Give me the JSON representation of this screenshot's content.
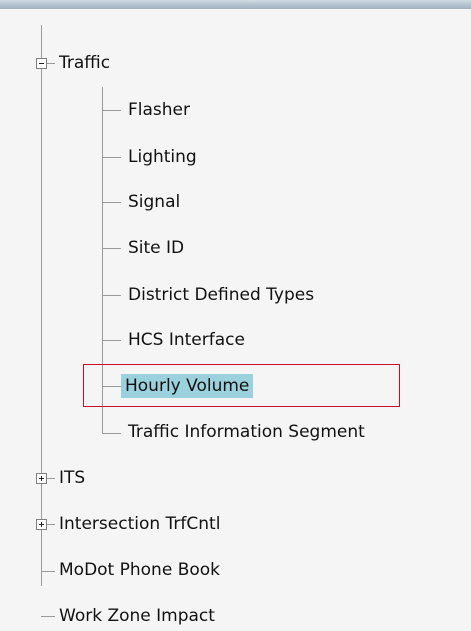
{
  "tree": {
    "traffic": {
      "label": "Traffic",
      "children": {
        "flasher": "Flasher",
        "lighting": "Lighting",
        "signal": "Signal",
        "site_id": "Site ID",
        "district_defined_types": "District Defined Types",
        "hcs_interface": "HCS Interface",
        "hourly_volume": "Hourly Volume",
        "traffic_information_segment": "Traffic Information Segment"
      }
    },
    "its": "ITS",
    "intersection_trfcntl": "Intersection TrfCntl",
    "modot_phone_book": "MoDot Phone Book",
    "work_zone_impact": "Work Zone Impact"
  },
  "selected_item": "Hourly Volume",
  "colors": {
    "selection": "#9bd1dc",
    "highlight_border": "#c8102e",
    "connector": "#9a9a9a"
  }
}
